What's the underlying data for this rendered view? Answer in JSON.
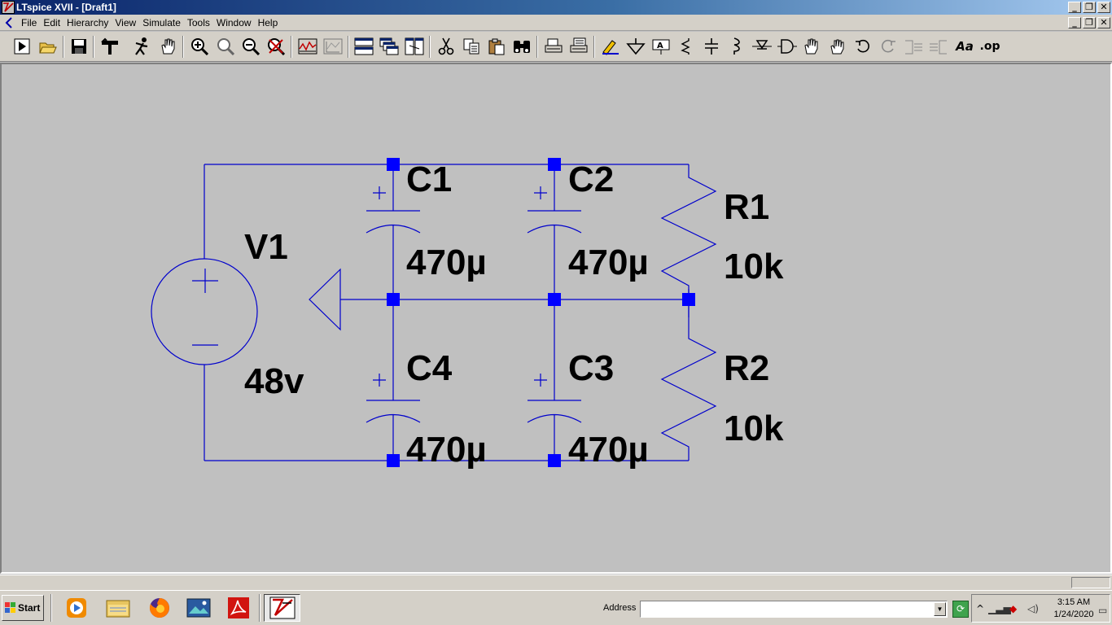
{
  "window": {
    "title": "LTspice XVII - [Draft1]"
  },
  "controls": {
    "minimize": "_",
    "restore": "❐",
    "close": "✕"
  },
  "menu": [
    "File",
    "Edit",
    "Hierarchy",
    "View",
    "Simulate",
    "Tools",
    "Window",
    "Help"
  ],
  "toolbar": {
    "icons": [
      "run-icon",
      "open-icon",
      "save-icon",
      "control-panel-icon",
      "halt-icon",
      "pan-icon",
      "zoom-in-icon",
      "zoom-back-icon",
      "zoom-out-icon",
      "zoom-fit-icon",
      "autorange-icon",
      "waveform-icon",
      "tile-horizontal-icon",
      "cascade-icon",
      "tile-vertical-icon",
      "cut-icon",
      "copy-icon",
      "paste-icon",
      "find-icon",
      "print-preview-icon",
      "print-icon",
      "draw-wire-icon",
      "ground-icon",
      "label-net-icon",
      "resistor-icon",
      "capacitor-icon",
      "inductor-icon",
      "diode-icon",
      "component-icon",
      "move-icon",
      "drag-icon",
      "undo-icon",
      "redo-icon",
      "rotate-icon",
      "mirror-icon",
      "text-icon",
      "spice-directive-icon"
    ],
    "text_text": "Aa",
    "directive_text": ".op"
  },
  "schematic": {
    "wire_color": "#0000cc",
    "node_color": "#0000ff",
    "components": [
      {
        "ref": "V1",
        "value": "48v"
      },
      {
        "ref": "C1",
        "value": "470µ"
      },
      {
        "ref": "C2",
        "value": "470µ"
      },
      {
        "ref": "C4",
        "value": "470µ"
      },
      {
        "ref": "C3",
        "value": "470µ"
      },
      {
        "ref": "R1",
        "value": "10k"
      },
      {
        "ref": "R2",
        "value": "10k"
      }
    ]
  },
  "taskbar": {
    "start_label": "Start",
    "apps": [
      "media-player-icon",
      "file-explorer-icon",
      "firefox-icon",
      "image-viewer-icon",
      "acrobat-icon",
      "ltspice-icon"
    ],
    "address_label": "Address",
    "address_value": "",
    "clock_time": "3:15 AM",
    "clock_date": "1/24/2020"
  }
}
